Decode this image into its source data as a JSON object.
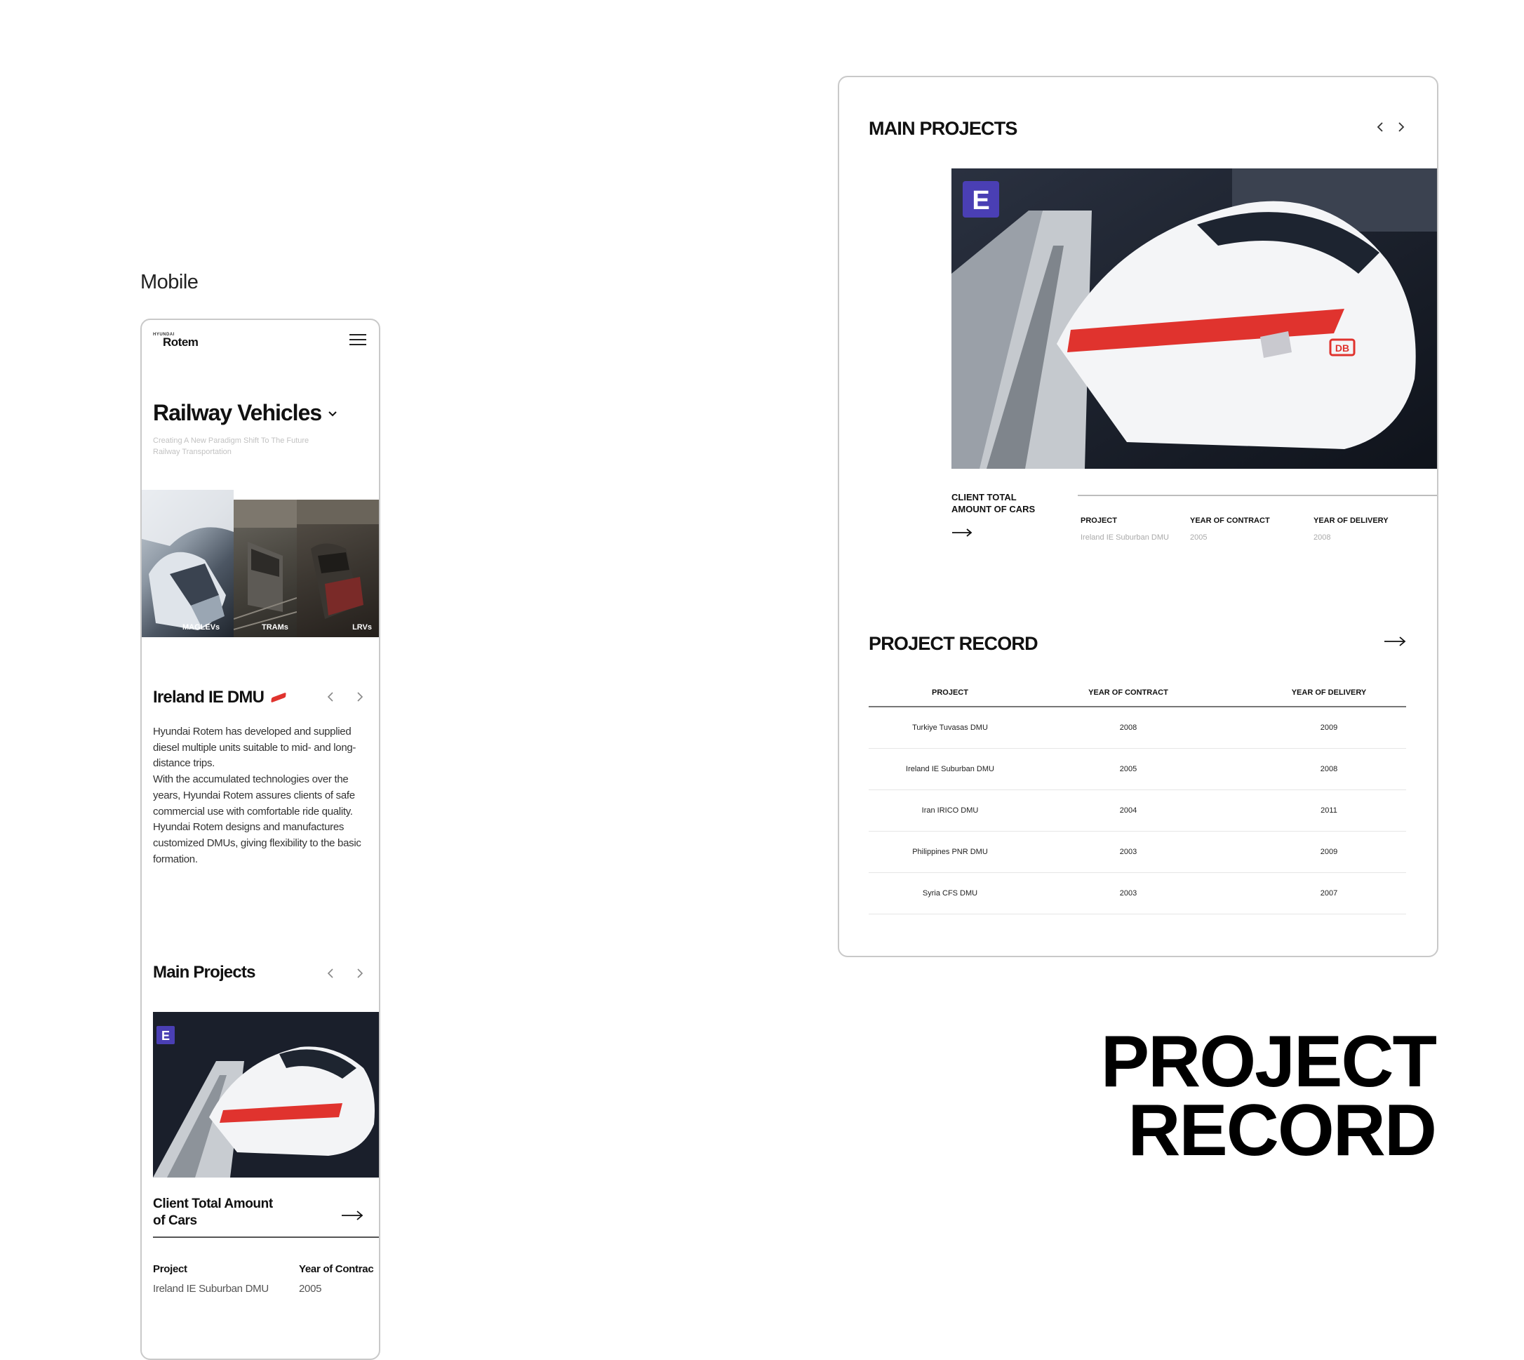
{
  "mobile": {
    "caption": "Mobile",
    "logo": {
      "small": "HYUNDAI",
      "big": "Rotem"
    },
    "title": "Railway Vehicles",
    "subtitle": "Creating A New Paradigm Shift To The Future Railway Transportation",
    "categories": [
      {
        "label": "MAGLEVs"
      },
      {
        "label": "TRAMs"
      },
      {
        "label": "LRVs"
      }
    ],
    "feature": {
      "title": "Ireland IE DMU",
      "paragraph1": "Hyundai Rotem has developed and supplied diesel multiple units suitable to mid- and long-distance trips.",
      "paragraph2": "With the accumulated technologies over the years, Hyundai Rotem assures clients of safe commercial use with comfortable ride quality. Hyundai Rotem designs and manufactures customized DMUs, giving flexibility to the basic formation."
    },
    "main_projects": {
      "title": "Main Projects",
      "photo_sign": "E",
      "client_label": "Client Total Amount of Cars",
      "headers": {
        "project": "Project",
        "year_contract": "Year of Contrac"
      },
      "row": {
        "project": "Ireland IE Suburban DMU",
        "year_contract": "2005"
      }
    }
  },
  "desktop": {
    "main_projects": {
      "title": "MAIN PROJECTS",
      "photo_sign": "E",
      "photo_badge": "DB",
      "client_label": "CLIENT TOTAL AMOUNT OF CARS",
      "headers": {
        "project": "PROJECT",
        "year_contract": "YEAR OF CONTRACT",
        "year_delivery": "YEAR OF DELIVERY"
      },
      "row": {
        "project": "Ireland IE Suburban DMU",
        "year_contract": "2005",
        "year_delivery": "2008"
      }
    },
    "project_record": {
      "title": "PROJECT RECORD",
      "headers": {
        "project": "PROJECT",
        "year_contract": "YEAR OF CONTRACT",
        "year_delivery": "YEAR OF DELIVERY"
      },
      "rows": [
        {
          "project": "Turkiye Tuvasas DMU",
          "year_contract": "2008",
          "year_delivery": "2009"
        },
        {
          "project": "Ireland IE Suburban DMU",
          "year_contract": "2005",
          "year_delivery": "2008"
        },
        {
          "project": "Iran IRICO DMU",
          "year_contract": "2004",
          "year_delivery": "2011"
        },
        {
          "project": "Philippines PNR DMU",
          "year_contract": "2003",
          "year_delivery": "2009"
        },
        {
          "project": "Syria CFS DMU",
          "year_contract": "2003",
          "year_delivery": "2007"
        }
      ]
    }
  },
  "page_title": {
    "line1": "PROJECT",
    "line2": "RECORD"
  },
  "colors": {
    "accent": "#e0332e",
    "sign": "#4a3fb4",
    "text": "#111111",
    "muted": "#c2c2c2"
  },
  "icons": [
    "menu-icon",
    "chevron-down-icon",
    "chevron-left-icon",
    "chevron-right-icon",
    "arrow-right-icon"
  ]
}
